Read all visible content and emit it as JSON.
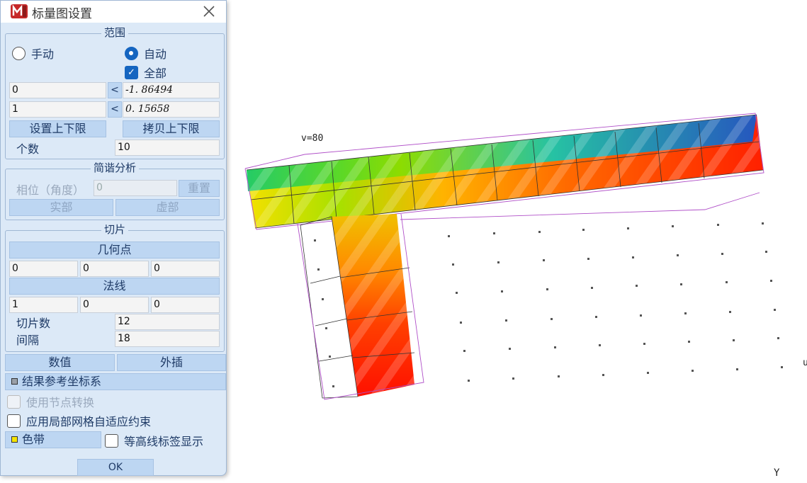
{
  "dialog": {
    "title": "标量图设置",
    "close": "✕",
    "range": {
      "title": "范围",
      "manual_label": "手动",
      "auto_label": "自动",
      "all_label": "全部",
      "min_index": "0",
      "min_value": "-1. 86494",
      "max_index": "1",
      "max_value": "0. 15658",
      "set_limits_button": "设置上下限",
      "copy_limits_button": "拷贝上下限",
      "count_label": "个数",
      "count_value": "10"
    },
    "harmonic": {
      "title": "简谐分析",
      "phase_label": "相位（角度）",
      "phase_value": "0",
      "reset_button": "重置",
      "real_button": "实部",
      "imag_button": "虚部"
    },
    "slice": {
      "title": "切片",
      "geom_point_button": "几何点",
      "point_x": "0",
      "point_y": "0",
      "point_z": "0",
      "normal_button": "法线",
      "normal_x": "1",
      "normal_y": "0",
      "normal_z": "0",
      "slice_count_label": "切片数",
      "slice_count_value": "12",
      "interval_label": "间隔",
      "interval_value": "18"
    },
    "value_button": "数值",
    "interp_button": "外插",
    "result_ref_button": "结果参考坐标系",
    "use_node_transform": "使用节点转换",
    "apply_local_mesh": "应用局部网格自适应约束",
    "color_band_button": "色带",
    "contour_label_check": "等高线标签显示",
    "ok_button": "OK"
  },
  "viewport": {
    "v_label": "v=80",
    "y_axis_label": "Y",
    "u_axis_label": "u"
  },
  "colors": {
    "dialog_bg": "#dce9f7",
    "button_bg": "#bdd6f2",
    "accent": "#1565c0"
  }
}
